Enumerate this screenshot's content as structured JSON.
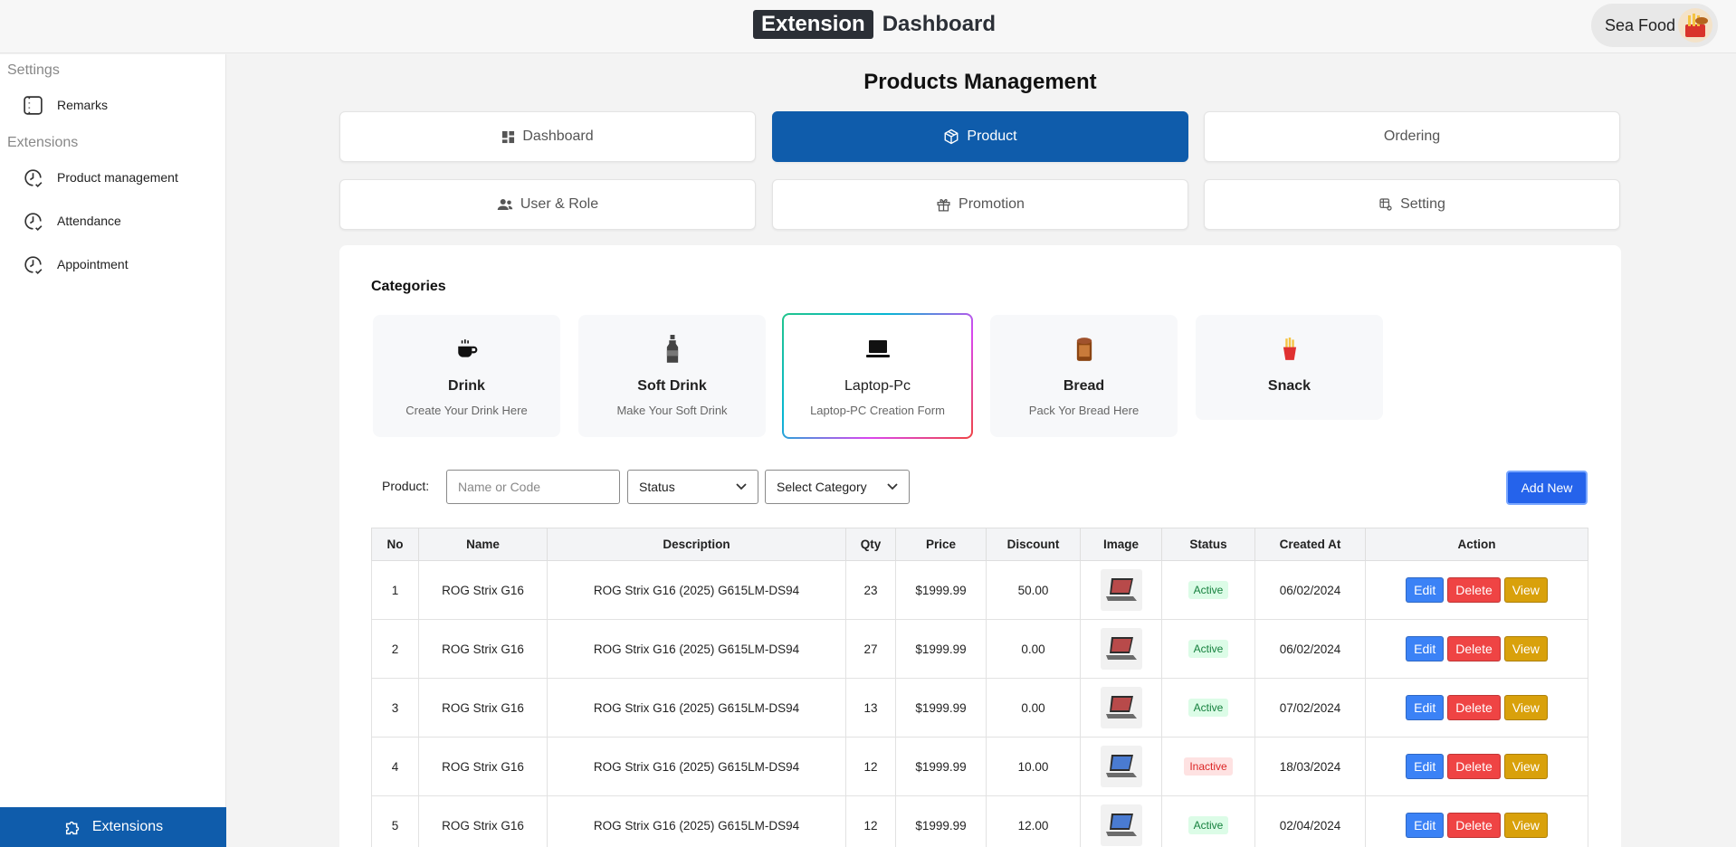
{
  "header": {
    "brand_box": "Extension",
    "brand_text": "Dashboard",
    "user_name": "Sea Food",
    "avatar_icon": "food-basket-icon"
  },
  "sidebar": {
    "section_settings": "Settings",
    "section_extensions": "Extensions",
    "items": [
      {
        "label": "Remarks",
        "icon": "note-icon"
      },
      {
        "label": "Product management",
        "icon": "clock-check-icon"
      },
      {
        "label": "Attendance",
        "icon": "clock-check-icon"
      },
      {
        "label": "Appointment",
        "icon": "clock-check-icon"
      }
    ],
    "footer_label": "Extensions",
    "footer_icon": "puzzle-icon"
  },
  "main": {
    "title": "Products Management",
    "tabs": [
      {
        "label": "Dashboard",
        "icon": "grid-icon",
        "active": false
      },
      {
        "label": "Product",
        "icon": "box-icon",
        "active": true
      },
      {
        "label": "Ordering",
        "icon": "",
        "active": false
      },
      {
        "label": "User & Role",
        "icon": "users-icon",
        "active": false
      },
      {
        "label": "Promotion",
        "icon": "gift-icon",
        "active": false
      },
      {
        "label": "Setting",
        "icon": "settings-icon",
        "active": false
      }
    ],
    "categories_heading": "Categories",
    "categories": [
      {
        "name": "Drink",
        "desc": "Create Your Drink Here",
        "icon": "coffee-cup-icon"
      },
      {
        "name": "Soft Drink",
        "desc": "Make Your Soft Drink",
        "icon": "bottle-icon"
      },
      {
        "name": "Laptop-Pc",
        "desc": "Laptop-PC Creation Form",
        "icon": "laptop-icon"
      },
      {
        "name": "Bread",
        "desc": "Pack Yor Bread Here",
        "icon": "bread-icon"
      },
      {
        "name": "Snack",
        "desc": "",
        "icon": "fries-icon"
      }
    ],
    "filter": {
      "label": "Product:",
      "search_placeholder": "Name or Code",
      "status_value": "Status",
      "category_value": "Select Category",
      "add_button": "Add New"
    },
    "table": {
      "columns": [
        "No",
        "Name",
        "Description",
        "Qty",
        "Price",
        "Discount",
        "Image",
        "Status",
        "Created At",
        "Action"
      ],
      "actions": {
        "edit": "Edit",
        "delete": "Delete",
        "view": "View"
      },
      "rows": [
        {
          "no": "1",
          "name": "ROG Strix G16",
          "description": "ROG Strix G16 (2025) G615LM-DS94",
          "qty": "23",
          "price": "$1999.99",
          "discount": "50.00",
          "status": "Active",
          "created": "06/02/2024"
        },
        {
          "no": "2",
          "name": "ROG Strix G16",
          "description": "ROG Strix G16 (2025) G615LM-DS94",
          "qty": "27",
          "price": "$1999.99",
          "discount": "0.00",
          "status": "Active",
          "created": "06/02/2024"
        },
        {
          "no": "3",
          "name": "ROG Strix G16",
          "description": "ROG Strix G16 (2025) G615LM-DS94",
          "qty": "13",
          "price": "$1999.99",
          "discount": "0.00",
          "status": "Active",
          "created": "07/02/2024"
        },
        {
          "no": "4",
          "name": "ROG Strix G16",
          "description": "ROG Strix G16 (2025) G615LM-DS94",
          "qty": "12",
          "price": "$1999.99",
          "discount": "10.00",
          "status": "Inactive",
          "created": "18/03/2024"
        },
        {
          "no": "5",
          "name": "ROG Strix G16",
          "description": "ROG Strix G16 (2025) G615LM-DS94",
          "qty": "12",
          "price": "$1999.99",
          "discount": "12.00",
          "status": "Active",
          "created": "02/04/2024"
        }
      ]
    }
  },
  "colors": {
    "primary": "#0f5cab",
    "add_button": "#2563eb",
    "edit": "#3b82f6",
    "delete": "#ef4444",
    "view": "#d9a10b"
  }
}
